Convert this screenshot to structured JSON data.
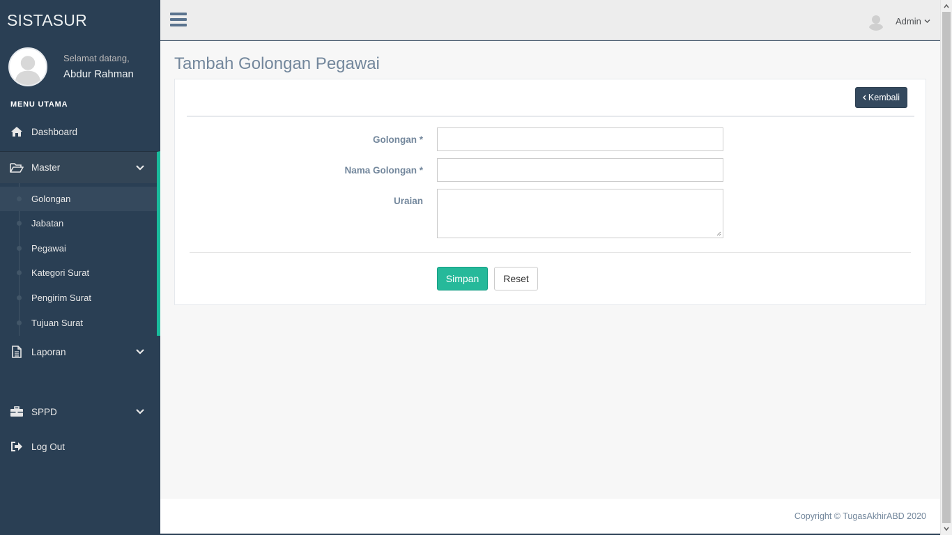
{
  "app": {
    "brand": "SISTASUR",
    "welcome": "Selamat datang,",
    "username": "Abdur Rahman"
  },
  "sidebar": {
    "section_title": "MENU UTAMA",
    "items": [
      {
        "label": "Dashboard",
        "icon": "home-icon"
      },
      {
        "label": "Master",
        "icon": "folder-open-icon"
      },
      {
        "label": "Laporan",
        "icon": "file-text-icon"
      },
      {
        "label": "SPPD",
        "icon": "briefcase-icon"
      },
      {
        "label": "Log Out",
        "icon": "sign-out-icon"
      }
    ],
    "master_sub": [
      {
        "label": "Golongan",
        "active": true
      },
      {
        "label": "Jabatan"
      },
      {
        "label": "Pegawai"
      },
      {
        "label": "Kategori Surat"
      },
      {
        "label": "Pengirim Surat"
      },
      {
        "label": "Tujuan Surat"
      }
    ]
  },
  "topnav": {
    "user": "Admin"
  },
  "page": {
    "title": "Tambah Golongan Pegawai",
    "back_button": "Kembali",
    "form": {
      "fields": [
        {
          "label": "Golongan *",
          "value": ""
        },
        {
          "label": "Nama Golongan *",
          "value": ""
        },
        {
          "label": "Uraian",
          "value": ""
        }
      ],
      "save_button": "Simpan",
      "reset_button": "Reset"
    }
  },
  "footer": {
    "text": "Copyright © TugasAkhirABD 2020"
  },
  "colors": {
    "sidebar_bg": "#2a3f54",
    "accent": "#1abb9c",
    "save_button": "#26b99a",
    "back_button": "#34495e",
    "text_muted": "#73879c"
  }
}
